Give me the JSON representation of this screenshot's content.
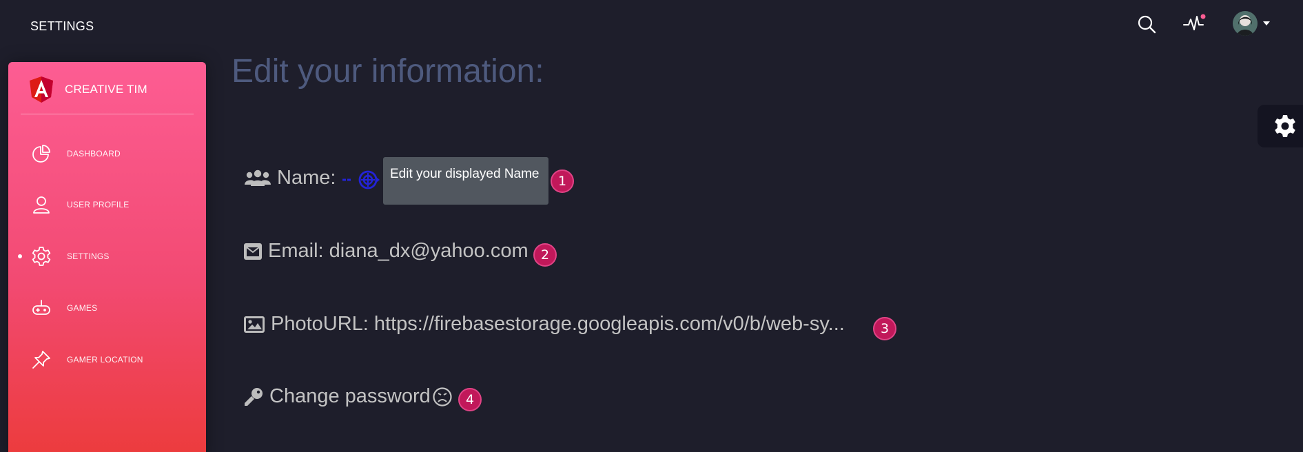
{
  "topbar": {
    "title": "SETTINGS",
    "notification_dot_color": "#fd5d93"
  },
  "sidebar": {
    "brand_name": "CREATIVE TIM",
    "brand_logo_letter": "A",
    "gradient_top": "#fd5d93",
    "gradient_bottom": "#ec3b3b",
    "items": [
      {
        "label": "DASHBOARD",
        "icon": "chart-pie-icon",
        "active": false
      },
      {
        "label": "USER PROFILE",
        "icon": "user-icon",
        "active": false
      },
      {
        "label": "SETTINGS",
        "icon": "gear-icon",
        "active": true
      },
      {
        "label": "GAMES",
        "icon": "gamepad-icon",
        "active": false
      },
      {
        "label": "GAMER LOCATION",
        "icon": "pin-icon",
        "active": false
      }
    ]
  },
  "main": {
    "title": "Edit your information:",
    "fields": [
      {
        "icon": "users-icon",
        "text": "Name:",
        "badge": "1"
      },
      {
        "icon": "envelope-icon",
        "text": "Email: diana_dx@yahoo.com",
        "badge": "2"
      },
      {
        "icon": "image-icon",
        "text": "PhotoURL: https://firebasestorage.googleapis.com/v0/b/web-sy...",
        "badge": "3"
      },
      {
        "icon": "key-icon",
        "text": "Change password",
        "badge": "4"
      }
    ],
    "tooltip": "Edit your displayed Name",
    "badge_color": "#c1185a"
  }
}
